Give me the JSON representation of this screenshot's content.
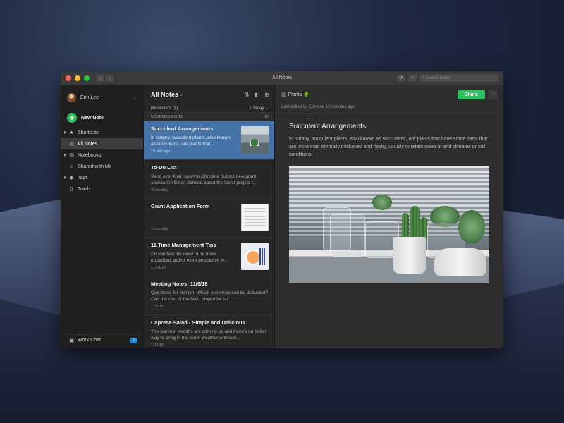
{
  "window": {
    "title": "All Notes",
    "search_placeholder": "Search notes"
  },
  "sidebar": {
    "user_name": "Erin Lee",
    "new_note_label": "New Note",
    "items": [
      {
        "label": "Shortcuts",
        "icon": "star-icon"
      },
      {
        "label": "All Notes",
        "icon": "note-icon"
      },
      {
        "label": "Notebooks",
        "icon": "notebook-icon"
      },
      {
        "label": "Shared with Me",
        "icon": "people-icon"
      },
      {
        "label": "Tags",
        "icon": "tag-icon"
      },
      {
        "label": "Trash",
        "icon": "trash-icon"
      }
    ],
    "work_chat_label": "Work Chat",
    "work_chat_badge": "2"
  },
  "notelist": {
    "title": "All Notes",
    "reminders_label": "Reminders (3)",
    "reminders_filter": "1 Today",
    "month_label": "NOVEMBER 2018",
    "month_count": "15",
    "notes": [
      {
        "title": "Succulent Arrangements",
        "snippet": "In botany, succulent plants, also known as succulents, are plants that...",
        "date": "10 min ago"
      },
      {
        "title": "To-Do List",
        "snippet": "Send over final report to Christine Submit new grant application Email Sahand about the latest project r...",
        "date": "Yesterday"
      },
      {
        "title": "Grant Application Form",
        "snippet": "",
        "date": "Yesterday"
      },
      {
        "title": "11 Time Management Tips",
        "snippet": "Do you feel the need to be more organized and/or more productive w...",
        "date": "11/10/18"
      },
      {
        "title": "Meeting Notes: 11/9/18",
        "snippet": "Questions for Marilyn: Which expenses can be deducted? Can the cost of the NAU project be su...",
        "date": "11/9/18"
      },
      {
        "title": "Caprese Salad - Simple and Delicious",
        "snippet": "The summer months are coming up and there's no better way to bring in the warm weather with deli...",
        "date": "11/9/18"
      }
    ]
  },
  "editor": {
    "notebook_name": "Plants",
    "share_label": "Share",
    "more_label": "···",
    "last_edited": "Last edited by Erin Lee 10 minutes ago",
    "title": "Succulent Arrangements",
    "body": "In botany, succulent plants, also known as succulents, are plants that have some parts that are more than normally thickened and fleshy, usually to retain water in arid climates or soil conditions."
  },
  "colors": {
    "accent_green": "#2dbe60",
    "selected_blue": "#4774a8",
    "badge_blue": "#1f8ad2"
  }
}
